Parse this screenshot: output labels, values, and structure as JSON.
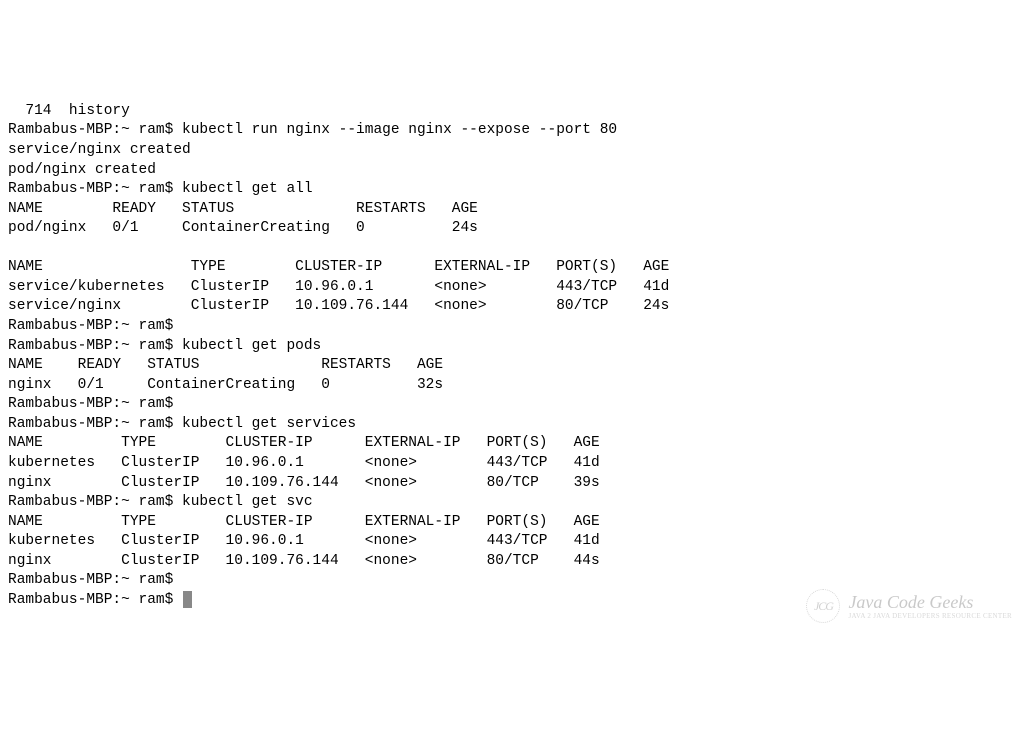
{
  "prompt": "Rambabus-MBP:~ ram$ ",
  "history_line": "  714  history",
  "cmd_run": "kubectl run nginx --image nginx --expose --port 80",
  "out_run_service": "service/nginx created",
  "out_run_pod": "pod/nginx created",
  "cmd_get_all": "kubectl get all",
  "get_all_pods_header": "NAME        READY   STATUS              RESTARTS   AGE",
  "get_all_pods_row": "pod/nginx   0/1     ContainerCreating   0          24s",
  "get_all_svc_header": "NAME                 TYPE        CLUSTER-IP      EXTERNAL-IP   PORT(S)   AGE",
  "get_all_svc_row1": "service/kubernetes   ClusterIP   10.96.0.1       <none>        443/TCP   41d",
  "get_all_svc_row2": "service/nginx        ClusterIP   10.109.76.144   <none>        80/TCP    24s",
  "cmd_get_pods": "kubectl get pods",
  "get_pods_header": "NAME    READY   STATUS              RESTARTS   AGE",
  "get_pods_row": "nginx   0/1     ContainerCreating   0          32s",
  "cmd_get_services": "kubectl get services",
  "get_services_header": "NAME         TYPE        CLUSTER-IP      EXTERNAL-IP   PORT(S)   AGE",
  "get_services_row1": "kubernetes   ClusterIP   10.96.0.1       <none>        443/TCP   41d",
  "get_services_row2": "nginx        ClusterIP   10.109.76.144   <none>        80/TCP    39s",
  "cmd_get_svc": "kubectl get svc",
  "get_svc_header": "NAME         TYPE        CLUSTER-IP      EXTERNAL-IP   PORT(S)   AGE",
  "get_svc_row1": "kubernetes   ClusterIP   10.96.0.1       <none>        443/TCP   41d",
  "get_svc_row2": "nginx        ClusterIP   10.109.76.144   <none>        80/TCP    44s",
  "watermark": {
    "logo_text": "JCG",
    "line1": "Java Code Geeks",
    "line2": "JAVA 2 JAVA DEVELOPERS RESOURCE CENTER"
  }
}
